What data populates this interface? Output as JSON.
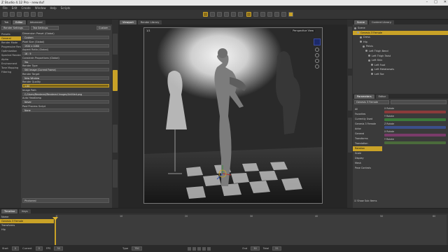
{
  "window": {
    "title": "Z Studio 4.12 Pro - new.duf",
    "controls": [
      "–",
      "□",
      "✕"
    ]
  },
  "menu": [
    "File",
    "Edit",
    "Create",
    "Window",
    "Help",
    "Scripts"
  ],
  "left_panel": {
    "tabs": [
      "Tab",
      "Editor",
      "Advanced"
    ],
    "preset_value": "Render Settings",
    "extra_tab": "Custom",
    "settings_label": "Tab Settings",
    "categories": [
      "Presets",
      "General",
      "Render Mode",
      "Progressive Rendering",
      "Optimization",
      "Spectral Rendering",
      "Alpha",
      "Environment",
      "Tone Mapping",
      "Filtering"
    ],
    "active_category": "General",
    "properties": [
      {
        "label": "Dimension Preset (Global)",
        "value": "Custom"
      },
      {
        "label": "Pixel Size (Global)",
        "value": "1920 x 1080"
      },
      {
        "label": "Aspect Ratio (Global)",
        "value": "16 : 9"
      },
      {
        "label": "Constrain Proportions (Global)",
        "value": "Yes"
      },
      {
        "label": "Render Type",
        "value": "Still Image (Current Frame)"
      },
      {
        "label": "Render Target",
        "value": "New Window"
      },
      {
        "label": "Render Quality",
        "value": "1.00",
        "highlight": true
      },
      {
        "label": "Image Path",
        "value": "C:/Users/Rendered/Rendered Images/Untitled.png"
      },
      {
        "label": "Auto Headlamp",
        "value": "Never"
      },
      {
        "label": "Post Process Script",
        "value": "None"
      }
    ],
    "render_mode": "Photoreal"
  },
  "viewport": {
    "tabs": [
      "Viewport",
      "Render Library"
    ],
    "frame_label": "1/1",
    "camera": "Perspective View"
  },
  "right_panel": {
    "top_tabs": [
      "Scene",
      "Content Library"
    ],
    "scene_items": [
      {
        "label": "Scene",
        "indent": 0
      },
      {
        "label": "Genesis 3 Female",
        "indent": 1,
        "selected": true
      },
      {
        "label": "Dress",
        "indent": 2
      },
      {
        "label": "Hip",
        "indent": 2
      },
      {
        "label": "Pelvis",
        "indent": 3
      },
      {
        "label": "Left Thigh Bend",
        "indent": 4
      },
      {
        "label": "Left Thigh Twist",
        "indent": 5
      },
      {
        "label": "Left Shin",
        "indent": 5
      },
      {
        "label": "Left Foot",
        "indent": 6
      },
      {
        "label": "Left Metatarsals",
        "indent": 6
      },
      {
        "label": "Left Toe",
        "indent": 6
      }
    ],
    "lower_tabs": [
      "Parameters",
      "Editor"
    ],
    "filter_value": "Genesis 3 Female",
    "param_groups": [
      "All",
      "Favorites",
      "Currently Used",
      "Genesis 3 Female",
      "Actor",
      "General",
      "Transforms",
      "Translation",
      "Rotation",
      "Scale",
      "Display",
      "Mesh",
      "Pose Controls"
    ],
    "selected_group": "Rotation",
    "params": [
      {
        "label": "X Rotate",
        "color": "#8a3b3b"
      },
      {
        "label": "Y Rotate",
        "color": "#3b7a3b"
      },
      {
        "label": "Z Rotate",
        "color": "#3b4f8a"
      },
      {
        "label": "X Rotate",
        "color": "#7a3b6a"
      },
      {
        "label": "Y Rotate",
        "color": "#4a6b3b"
      }
    ],
    "show_sub_items": "Show Sub Items"
  },
  "timeline": {
    "tabs": [
      "Timeline",
      "Keys"
    ],
    "header_label": "Name",
    "rows": [
      {
        "label": "Genesis 3 Female",
        "selected": true
      },
      {
        "label": "Transforms",
        "selected": false
      },
      {
        "label": "Hip",
        "selected": false
      }
    ],
    "ticks": [
      "0",
      "10",
      "20",
      "30",
      "40",
      "50",
      "60",
      "70"
    ]
  },
  "statusbar": {
    "start_label": "Start",
    "start_val": "0",
    "current_label": "Current",
    "current_val": "0",
    "fps_label": "FPS",
    "fps_val": "30",
    "type_label": "Type",
    "type_val": "TBC",
    "end_label": "End",
    "end_val": "30",
    "total_label": "Total",
    "total_val": "31"
  },
  "colors": {
    "accent": "#c9a227"
  }
}
